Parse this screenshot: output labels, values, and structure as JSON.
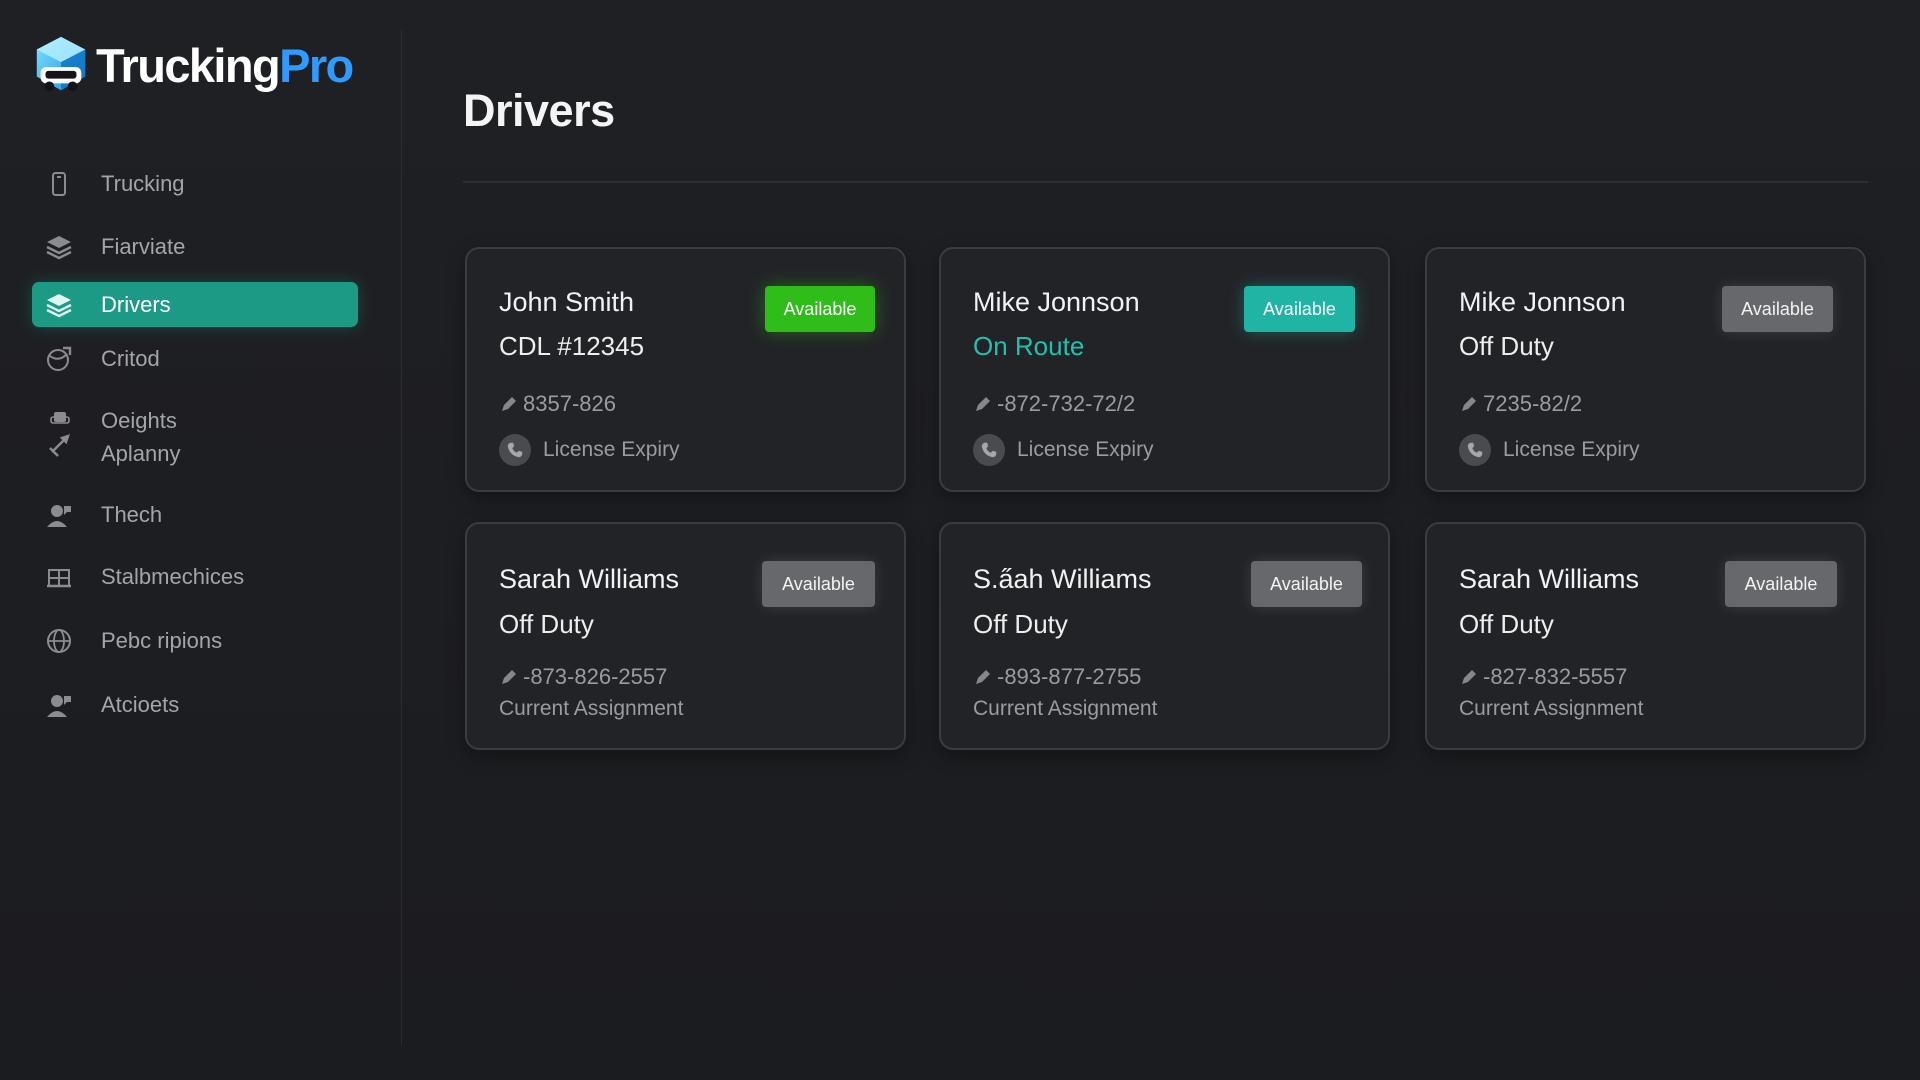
{
  "brand": {
    "name_main": "Trucking",
    "name_accent": "Pro"
  },
  "sidebar": {
    "items": [
      {
        "label": "Trucking",
        "icon": "phone-device-icon"
      },
      {
        "label": "Fiarviate",
        "icon": "layers-icon"
      },
      {
        "label": "Drivers",
        "icon": "layers-icon",
        "active": true
      },
      {
        "label": "Critod",
        "icon": "globe-arrow-icon"
      },
      {
        "label": "Oeights",
        "label2": "Aplanny",
        "icon": "robot-tools-icon"
      },
      {
        "label": "Thech",
        "icon": "person-speech-icon"
      },
      {
        "label": "Stalbmechices",
        "icon": "building-icon"
      },
      {
        "label": "Pebc ripions",
        "icon": "globe-icon"
      },
      {
        "label": "Atcioets",
        "icon": "person-speech-icon"
      }
    ]
  },
  "main": {
    "title": "Drivers"
  },
  "drivers": [
    {
      "name": "John Smith",
      "status": "CDL #12345",
      "phone": "8357-826",
      "extra": "License Expiry",
      "badge": "Available"
    },
    {
      "name": "Mike Jonnson",
      "status": "On Route",
      "phone": "-872-732-72/2",
      "extra": "License Expiry",
      "badge": "Available"
    },
    {
      "name": "Mike Jonnson",
      "status": "Off Duty",
      "phone": "7235-82/2",
      "extra": "License Expiry",
      "badge": "Available"
    },
    {
      "name": "Sarah Williams",
      "status": "Off Duty",
      "phone": "-873-826-2557",
      "extra": "Current Assignment",
      "badge": "Available"
    },
    {
      "name": "S.a̋ah Williams",
      "status": "Off Duty",
      "phone": "-893-877-2755",
      "extra": "Current Assignment",
      "badge": "Available"
    },
    {
      "name": "Sarah Williams",
      "status": "Off Duty",
      "phone": "-827-832-5557",
      "extra": "Current Assignment",
      "badge": "Available"
    }
  ],
  "colors": {
    "accent_teal": "#1d9a85",
    "badge_green": "#2fbd1a",
    "badge_teal": "#20b4a4",
    "badge_grey": "#67686c",
    "brand_blue": "#2f9bff"
  }
}
